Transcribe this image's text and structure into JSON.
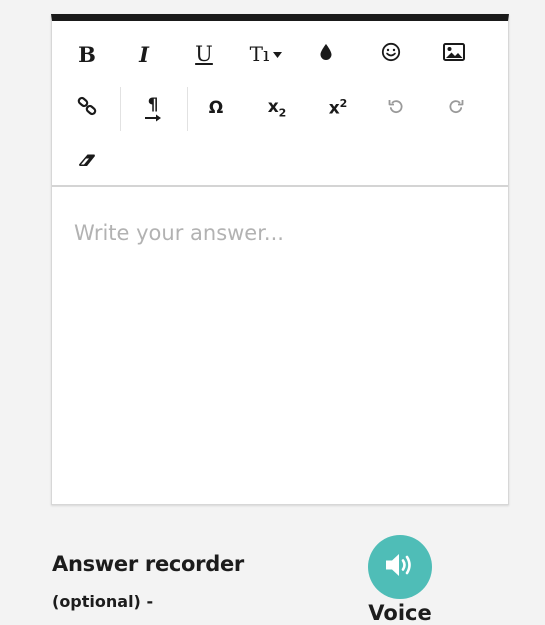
{
  "editor": {
    "placeholder": "Write your answer...",
    "toolbar": {
      "bold": "B",
      "italic": "I",
      "underline": "U",
      "font_size": "Tı",
      "special_chars": "Ω",
      "subscript_base": "x",
      "subscript_mark": "2",
      "superscript_base": "x",
      "superscript_mark": "2",
      "paragraph_mark": "¶"
    }
  },
  "recorder": {
    "title": "Answer recorder",
    "subtitle": "(optional) -",
    "voice_label": "Voice"
  },
  "colors": {
    "accent": "#4fbdb7",
    "toolbar_top": "#1a1a1a",
    "placeholder": "#b2b2b2",
    "disabled": "#9a9a9a"
  }
}
